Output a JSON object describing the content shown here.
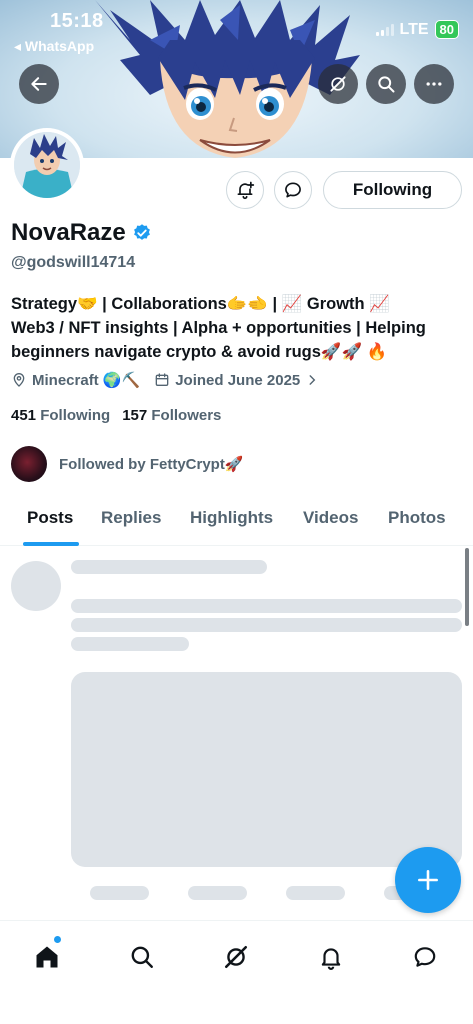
{
  "status_bar": {
    "time": "15:18",
    "back_app": "◂ WhatsApp",
    "network": "LTE",
    "battery": "80"
  },
  "header": {
    "back_icon": "arrow-left-icon",
    "grok_icon": "grok-icon",
    "search_icon": "search-icon",
    "more_icon": "more-icon"
  },
  "profile": {
    "display_name": "NovaRaze",
    "verified_color": "#1d9bf0",
    "handle": "@godswill14714",
    "following_button": "Following",
    "bio_lines": [
      "Strategy🤝 | Collaborations🫱🫲 | 📈 Growth 📈",
      "Web3 / NFT insights | Alpha + opportunities | Helping",
      "beginners navigate crypto & avoid rugs🚀🚀 🔥"
    ],
    "location": "Minecraft 🌍⛏️",
    "joined": "Joined June 2025",
    "following_count": "451",
    "following_label": "Following",
    "followers_count": "157",
    "followers_label": "Followers",
    "followed_by": "Followed by FettyCrypt🚀"
  },
  "tabs": [
    {
      "label": "Posts",
      "active": true
    },
    {
      "label": "Replies",
      "active": false
    },
    {
      "label": "Highlights",
      "active": false
    },
    {
      "label": "Videos",
      "active": false
    },
    {
      "label": "Photos",
      "active": false
    }
  ],
  "colors": {
    "accent": "#1d9bf0",
    "muted_text": "#536471",
    "skeleton": "#dee3e8"
  },
  "bottom_nav": [
    "home-icon",
    "search-icon",
    "grok-icon",
    "notifications-icon",
    "messages-icon"
  ]
}
